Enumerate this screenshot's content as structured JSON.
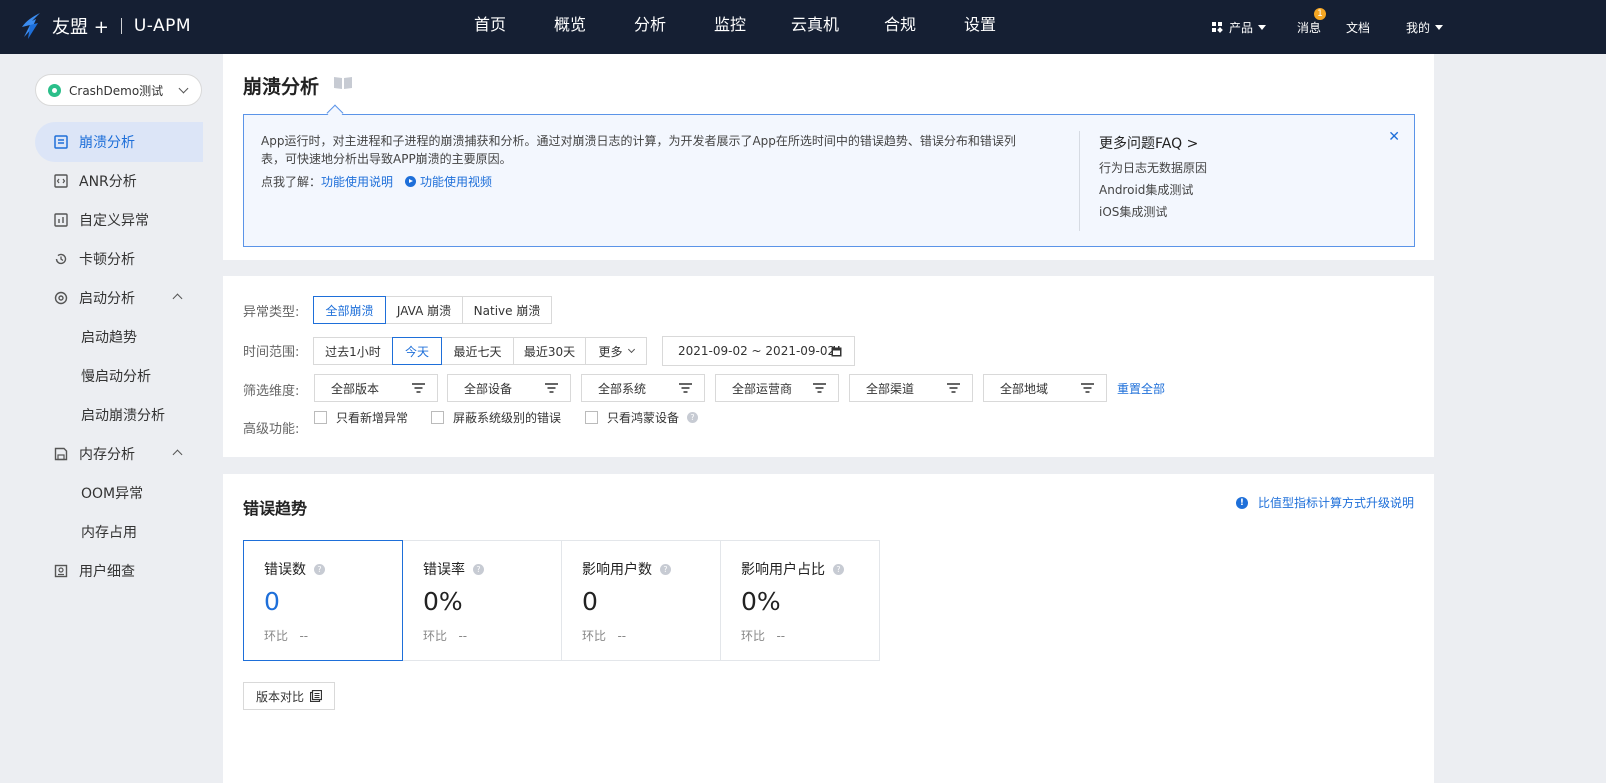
{
  "header": {
    "brand": "友盟 +",
    "product": "U-APM",
    "nav": [
      "首页",
      "概览",
      "分析",
      "监控",
      "云真机",
      "合规",
      "设置"
    ],
    "products_label": "产品",
    "messages_label": "消息",
    "messages_badge": "1",
    "docs_label": "文档",
    "mine_label": "我的"
  },
  "sidebar": {
    "app_name": "CrashDemo测试",
    "items": [
      {
        "label": "崩溃分析",
        "icon": "crash-report-icon"
      },
      {
        "label": "ANR分析",
        "icon": "anr-icon"
      },
      {
        "label": "自定义异常",
        "icon": "bar-chart-icon"
      },
      {
        "label": "卡顿分析",
        "icon": "history-icon"
      },
      {
        "label": "启动分析",
        "icon": "power-icon"
      },
      {
        "label": "启动趋势"
      },
      {
        "label": "慢启动分析"
      },
      {
        "label": "启动崩溃分析"
      },
      {
        "label": "内存分析",
        "icon": "save-icon"
      },
      {
        "label": "OOM异常"
      },
      {
        "label": "内存占用"
      },
      {
        "label": "用户细查",
        "icon": "user-profile-icon"
      }
    ]
  },
  "intro": {
    "title": "崩溃分析",
    "description": "App运行时，对主进程和子进程的崩溃捕获和分析。通过对崩溃日志的计算，为开发者展示了App在所选时间中的错误趋势、错误分布和错误列表，可快速地分析出导致APP崩溃的主要原因。",
    "learn_prefix": "点我了解：",
    "guide_link": "功能使用说明",
    "video_link": "功能使用视频",
    "faq_title": "更多问题FAQ >",
    "faq_items": [
      "行为日志无数据原因",
      "Android集成测试",
      "iOS集成测试"
    ]
  },
  "filters": {
    "type_label": "异常类型:",
    "types": [
      "全部崩溃",
      "JAVA 崩溃",
      "Native 崩溃"
    ],
    "selected_type": "全部崩溃",
    "time_label": "时间范围:",
    "times": [
      "过去1小时",
      "今天",
      "最近七天",
      "最近30天",
      "更多"
    ],
    "selected_time": "今天",
    "date_range": "2021-09-02 ~ 2021-09-02",
    "dimension_label": "筛选维度:",
    "dimensions": [
      "全部版本",
      "全部设备",
      "全部系统",
      "全部运营商",
      "全部渠道",
      "全部地域"
    ],
    "reset_label": "重置全部",
    "advanced_label": "高级功能:",
    "checkboxes": [
      "只看新增异常",
      "屏蔽系统级别的错误",
      "只看鸿蒙设备"
    ]
  },
  "trend": {
    "title": "错误趋势",
    "upgrade_note": "比值型指标计算方式升级说明",
    "metrics": [
      {
        "label": "错误数",
        "value": "0",
        "compare_label": "环比",
        "compare_value": "--"
      },
      {
        "label": "错误率",
        "value": "0%",
        "compare_label": "环比",
        "compare_value": "--"
      },
      {
        "label": "影响用户数",
        "value": "0",
        "compare_label": "环比",
        "compare_value": "--"
      },
      {
        "label": "影响用户占比",
        "value": "0%",
        "compare_label": "环比",
        "compare_value": "--"
      }
    ],
    "version_compare": "版本对比"
  },
  "colors": {
    "topbar": "#151f33",
    "accent": "#1e6fd9",
    "badge": "#f5a623"
  }
}
